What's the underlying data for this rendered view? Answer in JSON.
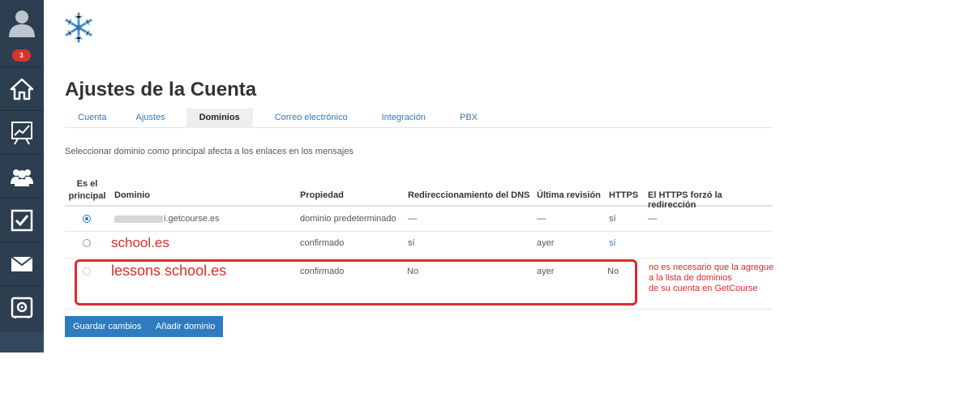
{
  "sidebar": {
    "notification_count": "3",
    "items": [
      {
        "name": "home"
      },
      {
        "name": "stats"
      },
      {
        "name": "users"
      },
      {
        "name": "tasks"
      },
      {
        "name": "messages"
      },
      {
        "name": "settings"
      }
    ]
  },
  "page": {
    "title": "Ajustes de la Cuenta",
    "description": "Seleccionar dominio como principal afecta a los enlaces en los mensajes"
  },
  "tabs": [
    {
      "label": "Cuenta",
      "active": false
    },
    {
      "label": "Ajustes",
      "active": false
    },
    {
      "label": "Dominios",
      "active": true
    },
    {
      "label": "Correo electrónico",
      "active": false
    },
    {
      "label": "Integración",
      "active": false
    },
    {
      "label": "PBX",
      "active": false
    }
  ],
  "table": {
    "headers": {
      "principal_line1": "Es el",
      "principal_line2": "principal",
      "domain": "Dominio",
      "property": "Propiedad",
      "dns": "Redireccionamiento del DNS",
      "last_check": "Última revisión",
      "https": "HTTPS",
      "https_forced": "El HTTPS forzó la redirección"
    },
    "rows": [
      {
        "selected": true,
        "domain": "i.getcourse.es",
        "property": "dominio predeterminado",
        "dns": "—",
        "last_check": "—",
        "https": "sí",
        "https_forced": "—"
      },
      {
        "selected": false,
        "domain": "school.es",
        "property": "confirmado",
        "dns": "sí",
        "last_check": "ayer",
        "https": "sí",
        "https_forced": ""
      },
      {
        "selected": false,
        "domain_prefix": "lessons",
        "domain_hidden": ".",
        "domain_suffix": "school.es",
        "property": "confirmado",
        "dns": "No",
        "last_check": "ayer",
        "https": "No",
        "https_forced": ""
      }
    ]
  },
  "annotation": {
    "line1": "no es necesario que la agregue",
    "line2": "a la lista de dominios",
    "line3": "de su cuenta en GetCourse",
    "color": "#e02a2a"
  },
  "buttons": {
    "save": "Guardar cambios",
    "add_domain": "Añadir dominio"
  },
  "colors": {
    "sidebar": "#2c3e50",
    "accent": "#2f7bbf",
    "link": "#3a76b6",
    "badge": "#d9342b"
  }
}
